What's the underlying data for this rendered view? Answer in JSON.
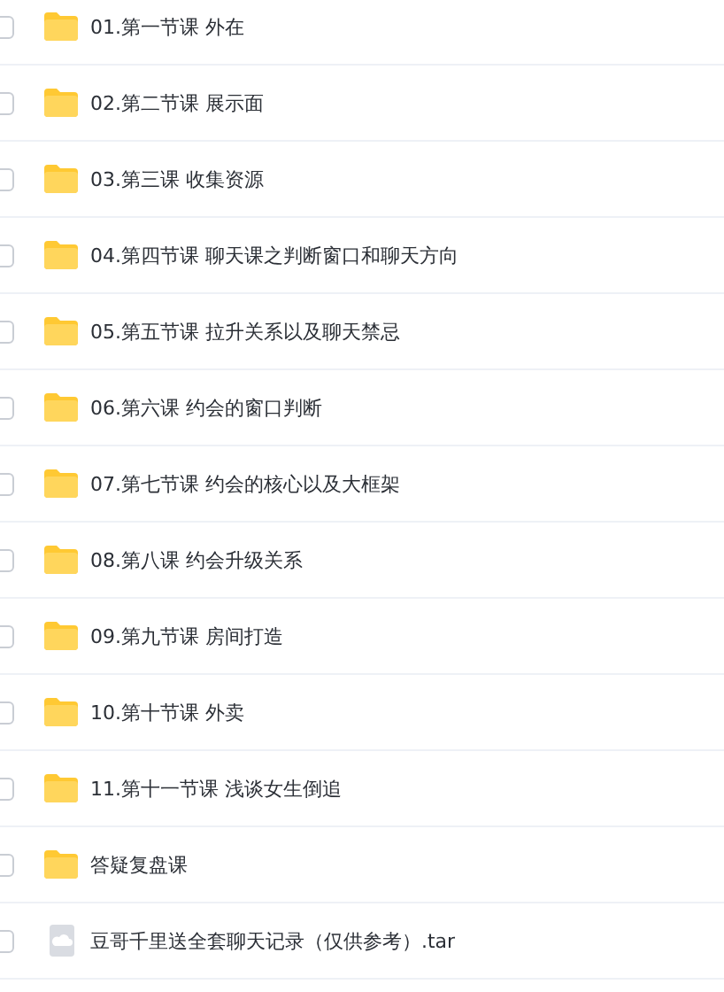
{
  "files": [
    {
      "kind": "folder",
      "name": "01.第一节课 外在",
      "checked": false
    },
    {
      "kind": "folder",
      "name": "02.第二节课 展示面",
      "checked": false
    },
    {
      "kind": "folder",
      "name": "03.第三课 收集资源",
      "checked": false
    },
    {
      "kind": "folder",
      "name": "04.第四节课 聊天课之判断窗口和聊天方向",
      "checked": false
    },
    {
      "kind": "folder",
      "name": "05.第五节课 拉升关系以及聊天禁忌",
      "checked": false
    },
    {
      "kind": "folder",
      "name": "06.第六课 约会的窗口判断",
      "checked": false
    },
    {
      "kind": "folder",
      "name": "07.第七节课 约会的核心以及大框架",
      "checked": false
    },
    {
      "kind": "folder",
      "name": "08.第八课 约会升级关系",
      "checked": false
    },
    {
      "kind": "folder",
      "name": "09.第九节课 房间打造",
      "checked": false
    },
    {
      "kind": "folder",
      "name": "10.第十节课 外卖",
      "checked": false
    },
    {
      "kind": "folder",
      "name": "11.第十一节课 浅谈女生倒追",
      "checked": false
    },
    {
      "kind": "folder",
      "name": "答疑复盘课",
      "checked": false
    },
    {
      "kind": "archive",
      "name": "豆哥千里送全套聊天记录（仅供参考）.tar",
      "checked": false
    }
  ]
}
